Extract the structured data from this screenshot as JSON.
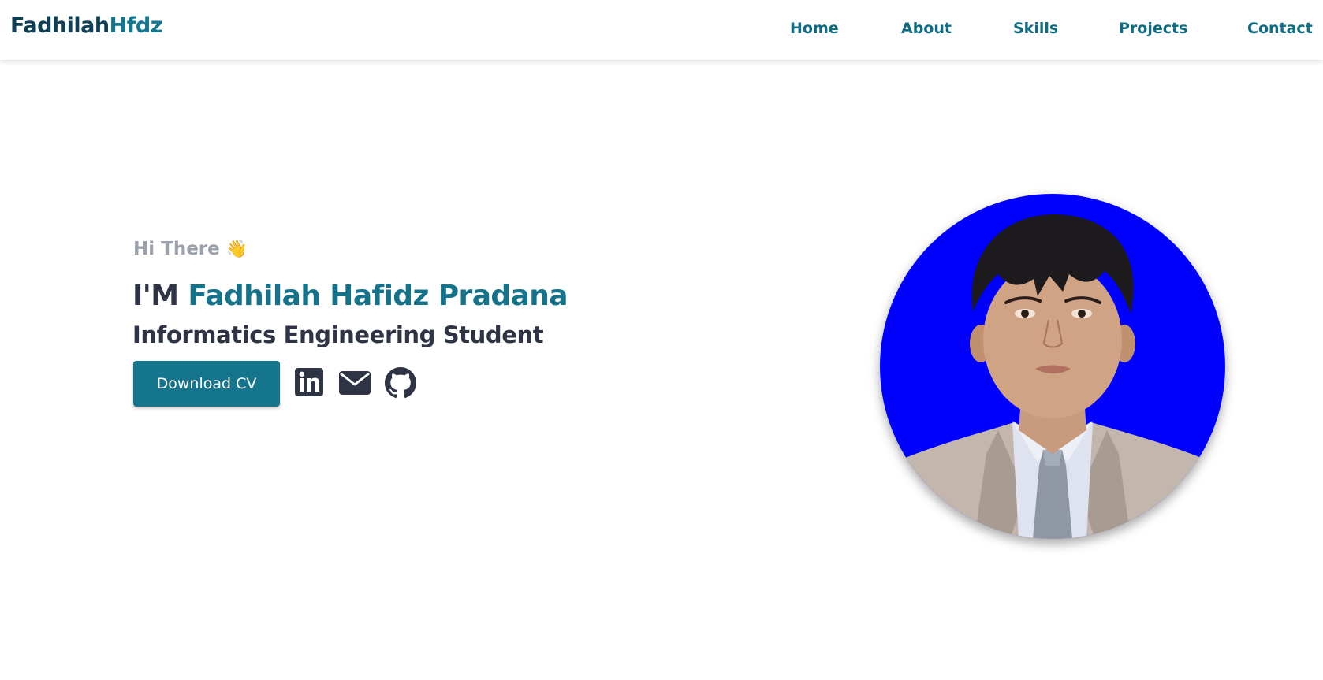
{
  "navbar": {
    "brand_first": "Fadhilah",
    "brand_second": "Hfdz",
    "links": [
      {
        "label": "Home"
      },
      {
        "label": "About"
      },
      {
        "label": "Skills"
      },
      {
        "label": "Projects"
      },
      {
        "label": "Contact"
      }
    ]
  },
  "hero": {
    "greeting": "Hi There",
    "greeting_emoji": "👋",
    "title_prefix": "I'M ",
    "title_name": "Fadhilah Hafidz Pradana",
    "subtitle": "Informatics Engineering Student",
    "download_button": "Download CV",
    "social_icons": [
      "linkedin-icon",
      "envelope-icon",
      "github-icon"
    ],
    "photo_background": "#0000ff"
  },
  "colors": {
    "accent": "#14758c",
    "brand_dark": "#0f3f55",
    "text_dark": "#2e3443",
    "muted": "#9aa1ab"
  }
}
